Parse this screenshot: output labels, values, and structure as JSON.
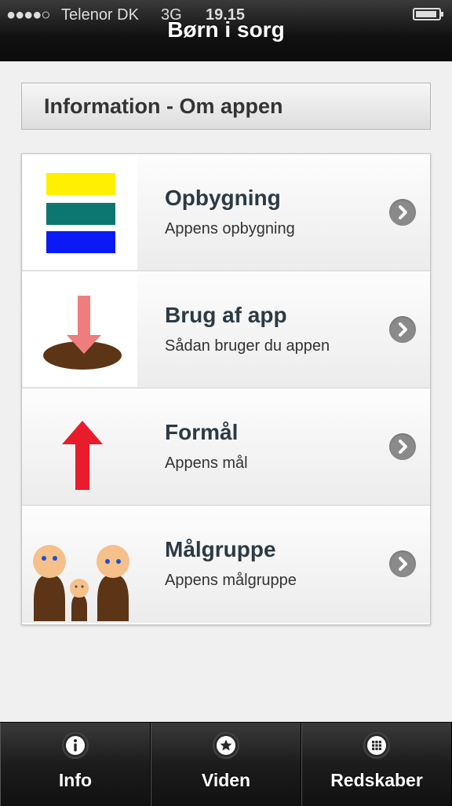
{
  "status_bar": {
    "signal": "●●●●○",
    "carrier": "Telenor DK",
    "network": "3G",
    "time": "19.15"
  },
  "header": {
    "title": "Børn i sorg"
  },
  "section": {
    "title": "Information - Om appen"
  },
  "list": {
    "items": [
      {
        "title": "Opbygning",
        "subtitle": "Appens opbygning",
        "icon": "stacked-bars-icon"
      },
      {
        "title": "Brug af app",
        "subtitle": "Sådan bruger du appen",
        "icon": "arrow-into-hole-icon"
      },
      {
        "title": "Formål",
        "subtitle": "Appens mål",
        "icon": "red-up-arrow-icon"
      },
      {
        "title": "Målgruppe",
        "subtitle": "Appens målgruppe",
        "icon": "family-figures-icon"
      }
    ]
  },
  "tabbar": {
    "tabs": [
      {
        "label": "Info",
        "icon": "info-icon"
      },
      {
        "label": "Viden",
        "icon": "star-icon"
      },
      {
        "label": "Redskaber",
        "icon": "grid-icon"
      }
    ]
  },
  "colors": {
    "yellow": "#ffef00",
    "teal": "#0b7770",
    "blue": "#0a1af5",
    "red": "#e81c2a",
    "brown": "#5c3517"
  }
}
